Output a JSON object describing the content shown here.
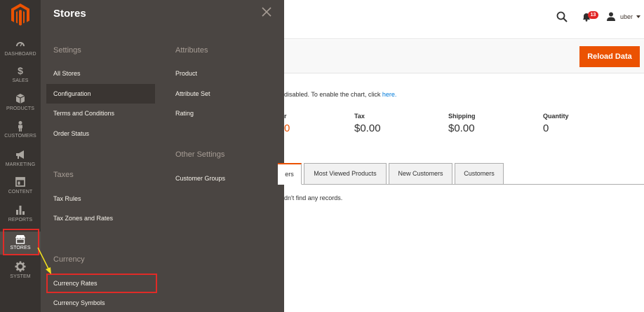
{
  "sidebar": {
    "items": [
      {
        "label": "DASHBOARD",
        "icon": "dashboard-icon"
      },
      {
        "label": "SALES",
        "icon": "dollar-icon"
      },
      {
        "label": "PRODUCTS",
        "icon": "cube-icon"
      },
      {
        "label": "CUSTOMERS",
        "icon": "person-icon"
      },
      {
        "label": "MARKETING",
        "icon": "megaphone-icon"
      },
      {
        "label": "CONTENT",
        "icon": "layout-icon"
      },
      {
        "label": "REPORTS",
        "icon": "bar-chart-icon"
      },
      {
        "label": "STORES",
        "icon": "storefront-icon"
      },
      {
        "label": "SYSTEM",
        "icon": "gear-icon"
      }
    ]
  },
  "panel": {
    "title": "Stores",
    "settings": {
      "title": "Settings",
      "items": [
        "All Stores",
        "Configuration",
        "Terms and Conditions",
        "Order Status"
      ]
    },
    "taxes": {
      "title": "Taxes",
      "items": [
        "Tax Rules",
        "Tax Zones and Rates"
      ]
    },
    "currency": {
      "title": "Currency",
      "items": [
        "Currency Rates",
        "Currency Symbols"
      ]
    },
    "attributes": {
      "title": "Attributes",
      "items": [
        "Product",
        "Attribute Set",
        "Rating"
      ]
    },
    "other": {
      "title": "Other Settings",
      "items": [
        "Customer Groups"
      ]
    }
  },
  "header": {
    "notifications_count": "13",
    "user_name": "uber"
  },
  "actions": {
    "reload_label": "Reload Data"
  },
  "dashboard": {
    "chart_note": "disabled. To enable the chart, click ",
    "chart_note_link": "here.",
    "stats": [
      {
        "label": "",
        "value": "0"
      },
      {
        "label": "Tax",
        "value": "$0.00"
      },
      {
        "label": "Shipping",
        "value": "$0.00"
      },
      {
        "label": "Quantity",
        "value": "0"
      }
    ],
    "first_stat_label_visible": "r",
    "tabs": [
      "ers",
      "Most Viewed Products",
      "New Customers",
      "Customers"
    ],
    "no_records": "dn't find any records."
  },
  "colors": {
    "accent": "#eb5202",
    "sidebar_bg": "#373330",
    "panel_bg": "#4a4542",
    "highlight_red": "#e02b27"
  }
}
